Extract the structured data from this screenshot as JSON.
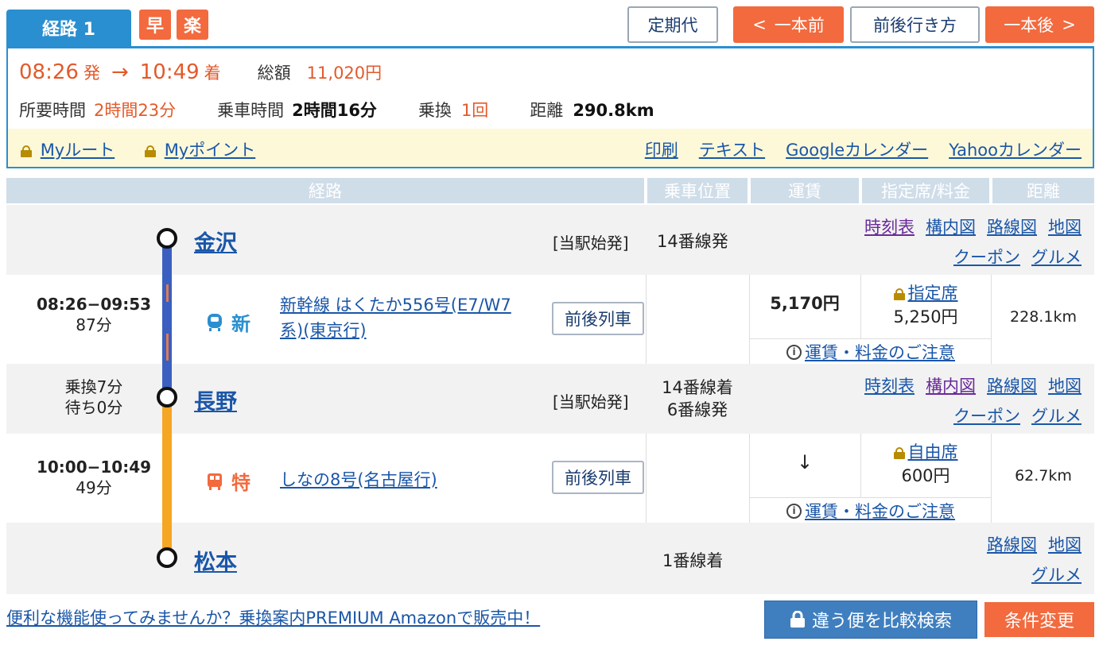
{
  "header": {
    "route_tab": "経路 1",
    "tags": [
      "早",
      "楽"
    ],
    "teikidai": "定期代",
    "prev": "一本前",
    "prev_arrow": "<",
    "around": "前後行き方",
    "next": "一本後",
    "next_arrow": ">"
  },
  "summary": {
    "dep_time": "08:26",
    "dep_suffix": "発",
    "arrow": "→",
    "arr_time": "10:49",
    "arr_suffix": "着",
    "total_label": "総額",
    "total_value": "11,020円",
    "duration_label": "所要時間",
    "duration_value": "2時間23分",
    "ride_label": "乗車時間",
    "ride_value": "2時間16分",
    "transfer_label": "乗換",
    "transfer_value": "1回",
    "distance_label": "距離",
    "distance_value": "290.8km"
  },
  "summary_links": {
    "my_route": "Myルート",
    "my_point": "Myポイント",
    "print": "印刷",
    "text": "テキスト",
    "google": "Googleカレンダー",
    "yahoo": "Yahooカレンダー"
  },
  "table_headers": [
    "経路",
    "乗車位置",
    "運賃",
    "指定席/料金",
    "距離"
  ],
  "stations": [
    {
      "name": "金沢",
      "origin": "[当駅始発]",
      "platform": "14番線発",
      "links_row1": [
        "時刻表",
        "構内図",
        "路線図",
        "地図"
      ],
      "links_row2": [
        "クーポン",
        "グルメ"
      ]
    },
    {
      "name": "長野",
      "transfer": "乗換7分",
      "wait": "待ち0分",
      "origin": "[当駅始発]",
      "platform_arr": "14番線着",
      "platform_dep": "6番線発",
      "links_row1": [
        "時刻表",
        "構内図",
        "路線図",
        "地図"
      ],
      "links_row2": [
        "クーポン",
        "グルメ"
      ]
    },
    {
      "name": "松本",
      "platform": "1番線着",
      "links_row1": [
        "路線図",
        "地図"
      ],
      "links_row2": [
        "グルメ"
      ]
    }
  ],
  "segments": [
    {
      "time": "08:26−09:53",
      "minutes": "87分",
      "type_label": "新",
      "type_color": "#2a8fd0",
      "line": "新幹線 はくたか556号(E7/W7系)(東京行)",
      "line_part1": "新幹線 はくたか556号(E7/W7",
      "line_part2": "系)(東京行)",
      "neighbor_btn": "前後列車",
      "fare": "5,170円",
      "seat_type": "指定席",
      "seat_fee": "5,250円",
      "notice": "運賃・料金のご注意",
      "distance": "228.1km",
      "line_color": "#3a5fc0"
    },
    {
      "time": "10:00−10:49",
      "minutes": "49分",
      "type_label": "特",
      "type_color": "#f26a3e",
      "line": "しなの8号(名古屋行)",
      "neighbor_btn": "前後列車",
      "fare": "↓",
      "seat_type": "自由席",
      "seat_fee": "600円",
      "notice": "運賃・料金のご注意",
      "distance": "62.7km",
      "line_color": "#f5a623"
    }
  ],
  "footer": {
    "promo": "便利な機能使ってみませんか？乗換案内PREMIUM Amazonで販売中！",
    "compare_btn": "違う便を比較検索",
    "change_btn": "条件変更"
  },
  "colors": {
    "accent_blue": "#2a8fd0",
    "accent_orange": "#f26a3e",
    "link": "#1a56a8",
    "link_visited": "#6a2a9a"
  }
}
